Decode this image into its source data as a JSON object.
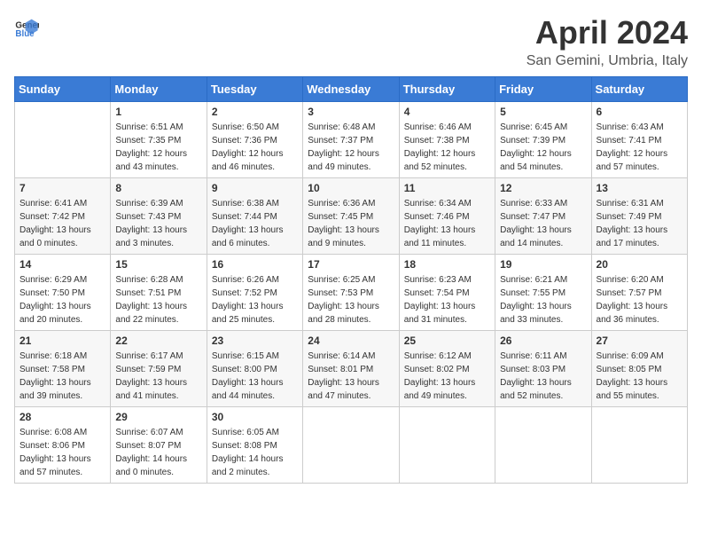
{
  "header": {
    "logo_general": "General",
    "logo_blue": "Blue",
    "month_title": "April 2024",
    "location": "San Gemini, Umbria, Italy"
  },
  "days_of_week": [
    "Sunday",
    "Monday",
    "Tuesday",
    "Wednesday",
    "Thursday",
    "Friday",
    "Saturday"
  ],
  "weeks": [
    [
      {
        "day": "",
        "info": ""
      },
      {
        "day": "1",
        "info": "Sunrise: 6:51 AM\nSunset: 7:35 PM\nDaylight: 12 hours\nand 43 minutes."
      },
      {
        "day": "2",
        "info": "Sunrise: 6:50 AM\nSunset: 7:36 PM\nDaylight: 12 hours\nand 46 minutes."
      },
      {
        "day": "3",
        "info": "Sunrise: 6:48 AM\nSunset: 7:37 PM\nDaylight: 12 hours\nand 49 minutes."
      },
      {
        "day": "4",
        "info": "Sunrise: 6:46 AM\nSunset: 7:38 PM\nDaylight: 12 hours\nand 52 minutes."
      },
      {
        "day": "5",
        "info": "Sunrise: 6:45 AM\nSunset: 7:39 PM\nDaylight: 12 hours\nand 54 minutes."
      },
      {
        "day": "6",
        "info": "Sunrise: 6:43 AM\nSunset: 7:41 PM\nDaylight: 12 hours\nand 57 minutes."
      }
    ],
    [
      {
        "day": "7",
        "info": "Sunrise: 6:41 AM\nSunset: 7:42 PM\nDaylight: 13 hours\nand 0 minutes."
      },
      {
        "day": "8",
        "info": "Sunrise: 6:39 AM\nSunset: 7:43 PM\nDaylight: 13 hours\nand 3 minutes."
      },
      {
        "day": "9",
        "info": "Sunrise: 6:38 AM\nSunset: 7:44 PM\nDaylight: 13 hours\nand 6 minutes."
      },
      {
        "day": "10",
        "info": "Sunrise: 6:36 AM\nSunset: 7:45 PM\nDaylight: 13 hours\nand 9 minutes."
      },
      {
        "day": "11",
        "info": "Sunrise: 6:34 AM\nSunset: 7:46 PM\nDaylight: 13 hours\nand 11 minutes."
      },
      {
        "day": "12",
        "info": "Sunrise: 6:33 AM\nSunset: 7:47 PM\nDaylight: 13 hours\nand 14 minutes."
      },
      {
        "day": "13",
        "info": "Sunrise: 6:31 AM\nSunset: 7:49 PM\nDaylight: 13 hours\nand 17 minutes."
      }
    ],
    [
      {
        "day": "14",
        "info": "Sunrise: 6:29 AM\nSunset: 7:50 PM\nDaylight: 13 hours\nand 20 minutes."
      },
      {
        "day": "15",
        "info": "Sunrise: 6:28 AM\nSunset: 7:51 PM\nDaylight: 13 hours\nand 22 minutes."
      },
      {
        "day": "16",
        "info": "Sunrise: 6:26 AM\nSunset: 7:52 PM\nDaylight: 13 hours\nand 25 minutes."
      },
      {
        "day": "17",
        "info": "Sunrise: 6:25 AM\nSunset: 7:53 PM\nDaylight: 13 hours\nand 28 minutes."
      },
      {
        "day": "18",
        "info": "Sunrise: 6:23 AM\nSunset: 7:54 PM\nDaylight: 13 hours\nand 31 minutes."
      },
      {
        "day": "19",
        "info": "Sunrise: 6:21 AM\nSunset: 7:55 PM\nDaylight: 13 hours\nand 33 minutes."
      },
      {
        "day": "20",
        "info": "Sunrise: 6:20 AM\nSunset: 7:57 PM\nDaylight: 13 hours\nand 36 minutes."
      }
    ],
    [
      {
        "day": "21",
        "info": "Sunrise: 6:18 AM\nSunset: 7:58 PM\nDaylight: 13 hours\nand 39 minutes."
      },
      {
        "day": "22",
        "info": "Sunrise: 6:17 AM\nSunset: 7:59 PM\nDaylight: 13 hours\nand 41 minutes."
      },
      {
        "day": "23",
        "info": "Sunrise: 6:15 AM\nSunset: 8:00 PM\nDaylight: 13 hours\nand 44 minutes."
      },
      {
        "day": "24",
        "info": "Sunrise: 6:14 AM\nSunset: 8:01 PM\nDaylight: 13 hours\nand 47 minutes."
      },
      {
        "day": "25",
        "info": "Sunrise: 6:12 AM\nSunset: 8:02 PM\nDaylight: 13 hours\nand 49 minutes."
      },
      {
        "day": "26",
        "info": "Sunrise: 6:11 AM\nSunset: 8:03 PM\nDaylight: 13 hours\nand 52 minutes."
      },
      {
        "day": "27",
        "info": "Sunrise: 6:09 AM\nSunset: 8:05 PM\nDaylight: 13 hours\nand 55 minutes."
      }
    ],
    [
      {
        "day": "28",
        "info": "Sunrise: 6:08 AM\nSunset: 8:06 PM\nDaylight: 13 hours\nand 57 minutes."
      },
      {
        "day": "29",
        "info": "Sunrise: 6:07 AM\nSunset: 8:07 PM\nDaylight: 14 hours\nand 0 minutes."
      },
      {
        "day": "30",
        "info": "Sunrise: 6:05 AM\nSunset: 8:08 PM\nDaylight: 14 hours\nand 2 minutes."
      },
      {
        "day": "",
        "info": ""
      },
      {
        "day": "",
        "info": ""
      },
      {
        "day": "",
        "info": ""
      },
      {
        "day": "",
        "info": ""
      }
    ]
  ]
}
